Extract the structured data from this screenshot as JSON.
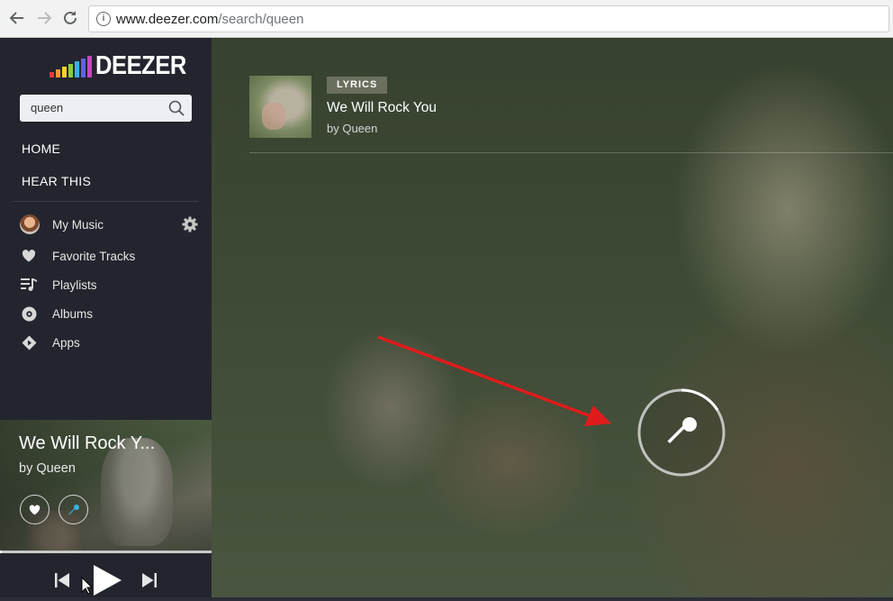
{
  "browser": {
    "url_domain": "www.deezer.com",
    "url_path": "/search/queen",
    "back_icon": "back-arrow-icon",
    "forward_icon": "forward-arrow-icon",
    "reload_icon": "reload-icon"
  },
  "sidebar": {
    "logo_text": "DEEZER",
    "logo_colors": [
      "#e53b3b",
      "#f29a2e",
      "#fbd02e",
      "#8ccb41",
      "#3ab2e1",
      "#5d64e0",
      "#c746c1"
    ],
    "search": {
      "value": "queen",
      "placeholder": ""
    },
    "nav": {
      "home": "HOME",
      "hear_this": "HEAR THIS"
    },
    "menu": {
      "my_music": "My Music",
      "favorite_tracks": "Favorite Tracks",
      "playlists": "Playlists",
      "albums": "Albums",
      "apps": "Apps"
    }
  },
  "now_playing": {
    "title": "We Will Rock Y...",
    "artist": "by Queen",
    "progress": 0.01
  },
  "result": {
    "badge": "LYRICS",
    "title": "We Will Rock You",
    "artist": "by Queen"
  },
  "colors": {
    "sidebar_bg": "#23252e",
    "annotation_arrow": "#e01b1b"
  }
}
